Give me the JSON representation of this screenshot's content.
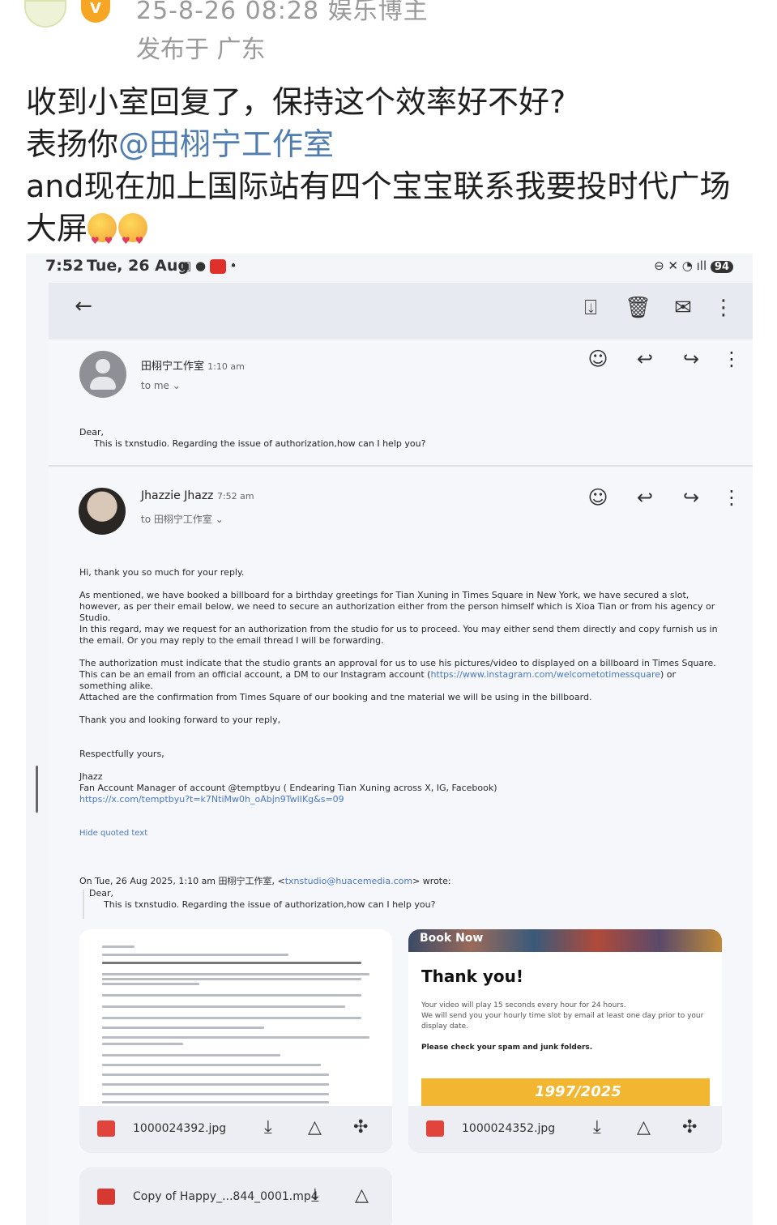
{
  "post": {
    "meta_line1": "25-8-26 08:28  娱乐博主",
    "meta_line2": "发布于 广东",
    "line1": "收到小室回复了，保持这个效率好不好?",
    "line2_prefix": "表扬你",
    "line2_mention": "@田栩宁工作室",
    "line3": "and现在加上国际站有四个宝宝联系我要投时代广场",
    "line4": "大屏"
  },
  "status_bar": {
    "time": "7:52",
    "date": "Tue, 26 Aug",
    "battery": "94"
  },
  "message1": {
    "sender": "田栩宁工作室",
    "time": "1:10 am",
    "to": "to me",
    "greeting": "Dear,",
    "body": "This is txnstudio. Regarding the issue of authorization,how can I help you?"
  },
  "message2": {
    "sender": "Jhazzie Jhazz",
    "time": "7:52 am",
    "to": "to 田栩宁工作室",
    "p1": "Hi, thank you so much for your reply.",
    "p2": "As mentioned, we have booked a billboard for a birthday greetings for Tian Xuning in Times Square in New York, we have secured a slot, however, as per their email below, we need to secure an authorization either from the person himself which is Xioa Tian or from his agency or Studio.",
    "p3": "In this regard, may we request for an authorization from the studio for us to proceed. You may either send them directly and copy furnish us in the email. Or you may reply to the email thread I  will be forwarding.",
    "p4_a": "The authorization must indicate that the studio grants an approval for us to use his pictures/video to displayed on a billboard in Times Square. This can be an email from an official account, a DM to our Instagram account (",
    "p4_link": "https://www.instagram.com/welcometotimessquare",
    "p4_b": ") or something alike.",
    "p5": "Attached are the confirmation from Times Square of our booking and tne material we will be using in the billboard.",
    "p6": "Thank you and looking forward to your reply,",
    "p7": "Respectfully yours,",
    "sig_name": "Jhazz",
    "sig_title": "Fan Account Manager of account @temptbyu ( Endearing Tian Xuning across X, IG, Facebook)",
    "sig_link": "https://x.com/temptbyu?t=k7NtiMw0h_oAbjn9TwlIKg&s=09",
    "hide_quoted": "Hide quoted text",
    "quote_header_a": "On Tue, 26 Aug 2025, 1:10 am 田栩宁工作室, <",
    "quote_email": "txnstudio@huacemedia.com",
    "quote_header_b": "> wrote:",
    "quote_greeting": "Dear,",
    "quote_body": "This is txnstudio. Regarding the issue of authorization,how can I help you?"
  },
  "attachments": [
    {
      "name": "1000024392.jpg"
    },
    {
      "name": "1000024352.jpg",
      "banner": "Book Now",
      "heading": "Thank you!",
      "line1": "Your video will play 15 seconds every hour for 24 hours.",
      "line2": "We will send you your hourly time slot by email at least one day prior to your display date.",
      "line3": "Please check your spam and junk folders.",
      "strip": "1997/2025"
    },
    {
      "name": "Copy of Happy_...844_0001.mp4"
    }
  ]
}
